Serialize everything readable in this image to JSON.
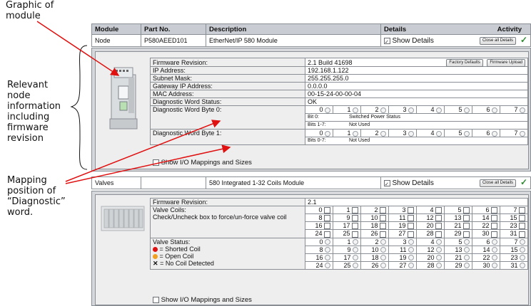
{
  "annotations": {
    "graphic": "Graphic of\nmodule",
    "node_info": "Relevant\nnode\ninformation\nincluding\nfirmware\nrevision",
    "mapping": "Mapping\nposition of\n“Diagnostic”\nword."
  },
  "table_header": {
    "module": "Module",
    "part_no": "Part No.",
    "description": "Description",
    "details": "Details",
    "activity": "Activity"
  },
  "node_row": {
    "module": "Node",
    "part_no": "P580AEED101",
    "description": "EtherNet/IP 580 Module",
    "show_details": "Show Details",
    "close_all": "Close all Details"
  },
  "node_panel": {
    "buttons": {
      "factory": "Factory Defaults",
      "upload": "Firmware Upload"
    },
    "fields": [
      {
        "label": "Firmware Revision:",
        "value": "2.1 Build 41698"
      },
      {
        "label": "IP Address:",
        "value": "192.168.1.122"
      },
      {
        "label": "Subnet Mask:",
        "value": "255.255.255.0"
      },
      {
        "label": "Gateway IP Address:",
        "value": "0.0.0.0"
      },
      {
        "label": "MAC Address:",
        "value": "00-15-24-00-00-04"
      },
      {
        "label": "Diagnostic Word Status:",
        "value": "OK"
      }
    ],
    "byte0_label": "Diagnostic Word Byte 0:",
    "byte1_label": "Diagnostic Word Byte 1:",
    "bits": [
      "0",
      "1",
      "2",
      "3",
      "4",
      "5",
      "6",
      "7"
    ],
    "byte0_note_a_key": "Bit 0:",
    "byte0_note_a_val": "Switched Power Status",
    "byte0_note_b_key": "Bits 1-7:",
    "byte0_note_b_val": "Not Used",
    "byte1_note_key": "Bits 0-7:",
    "byte1_note_val": "Not Used",
    "show_io": "Show I/O Mappings and Sizes"
  },
  "valves_row": {
    "module": "Valves",
    "part_no": "",
    "description": "580 Integrated 1-32 Coils Module",
    "show_details": "Show Details",
    "close_all": "Close all Details"
  },
  "valves_panel": {
    "fw_label": "Firmware Revision:",
    "fw_value": "2.1",
    "coils_label": "Valve Coils:",
    "coils_hint": "Check/Uncheck box to force/un-force valve coil",
    "status_label": "Valve Status:",
    "legend": [
      {
        "text": "= Shorted Coil",
        "color": "#e01010"
      },
      {
        "text": "= Open Coil",
        "color": "#f0a020"
      },
      {
        "text": "= No Coil Detected",
        "color": "#000000"
      }
    ],
    "legend_x": "✕",
    "coil_rows": [
      [
        "0",
        "1",
        "2",
        "3",
        "4",
        "5",
        "6",
        "7"
      ],
      [
        "8",
        "9",
        "10",
        "11",
        "12",
        "13",
        "14",
        "15"
      ],
      [
        "16",
        "17",
        "18",
        "19",
        "20",
        "21",
        "22",
        "23"
      ],
      [
        "24",
        "25",
        "26",
        "27",
        "28",
        "29",
        "30",
        "31"
      ]
    ],
    "show_io": "Show I/O Mappings and Sizes"
  },
  "colors": {
    "arrow": "#e01010",
    "check_green": "#2e8b2e"
  }
}
